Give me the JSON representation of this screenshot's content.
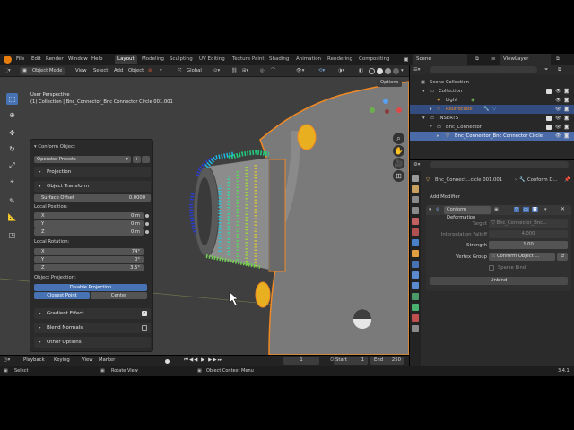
{
  "menu": [
    "File",
    "Edit",
    "Render",
    "Window",
    "Help"
  ],
  "workspaces": [
    "Layout",
    "Modeling",
    "Sculpting",
    "UV Editing",
    "Texture Paint",
    "Shading",
    "Animation",
    "Rendering",
    "Compositing"
  ],
  "scene": "Scene",
  "view_layer": "ViewLayer",
  "viewport_header": {
    "mode": "Object Mode",
    "view": "View",
    "select": "Select",
    "add": "Add",
    "object": "Object",
    "transform": "Global",
    "options": "Options"
  },
  "viewport_info": {
    "line1": "User Perspective",
    "line2": "(1) Collection | Bnc_Connector_Bnc Connector Circle 001.001"
  },
  "operator_panel": {
    "title": "Conform Object",
    "presets": "Operator Presets",
    "projection": "Projection",
    "object_transform": "Object Transform",
    "surface_offset_label": "Surface Offset",
    "surface_offset": "0.0000",
    "local_position": "Local Position:",
    "pos_x_label": "X",
    "pos_x": "0 m",
    "pos_y_label": "Y",
    "pos_y": "0 m",
    "pos_z_label": "Z",
    "pos_z": "0 m",
    "local_rotation": "Local Rotation:",
    "rot_x_label": "X",
    "rot_x": "74°",
    "rot_y_label": "Y",
    "rot_y": "0°",
    "rot_z_label": "Z",
    "rot_z": "3.5°",
    "object_projection": "Object Projection:",
    "disable_projection": "Disable Projection",
    "closest_point": "Closest Point",
    "center": "Center",
    "gradient_effect": "Gradient Effect",
    "blend_normals": "Blend Normals",
    "other_options": "Other Options"
  },
  "timeline": {
    "playback": "Playback",
    "keying": "Keying",
    "view": "View",
    "marker": "Marker",
    "current_frame": "1",
    "start_label": "Start",
    "start": "1",
    "end_label": "End",
    "end": "250"
  },
  "statusbar": {
    "select": "Select",
    "rotate_view": "Rotate View",
    "context_menu": "Object Context Menu",
    "version": "3.4.1"
  },
  "outliner": {
    "scene_collection": "Scene Collection",
    "collection": "Collection",
    "light": "Light",
    "roundcube": "Roundcube",
    "inserts": "INSERTS",
    "bnc_connector": "Bnc_Connector",
    "bnc_circle": "Bnc_Connector_Bnc Connector Circle 0"
  },
  "properties": {
    "object_name": "Bnc_Connect...cicle 001.001",
    "modifier_short": "Conform D...",
    "add_modifier": "Add Modifier",
    "modifier_name": "Conform Deformation",
    "target_label": "Target",
    "target": "Bnc_Connector_Bnc...",
    "interp_label": "Interpolation Falloff",
    "interp": "4.000",
    "strength_label": "Strength",
    "strength": "1.00",
    "vgroup_label": "Vertex Group",
    "vgroup": "Conform Object ...",
    "sparse_bind": "Sparse Bind",
    "unbind": "Unbind"
  },
  "colors": {
    "accent": "#4772b3",
    "selected_orange": "#f08a24",
    "viewport_bg": "#3f3f3f"
  }
}
